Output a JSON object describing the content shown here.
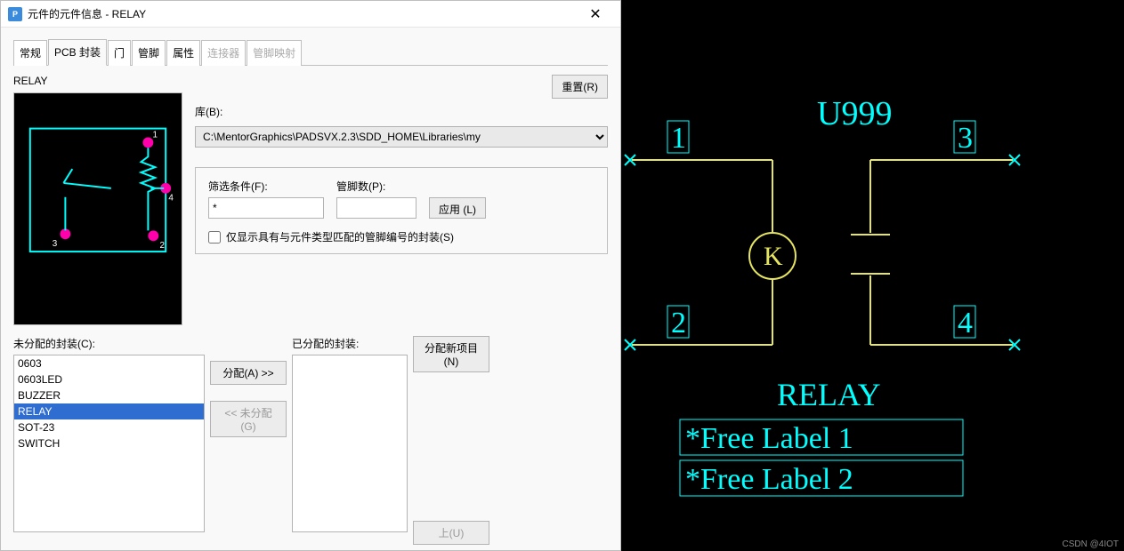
{
  "window": {
    "title": "元件的元件信息 - RELAY",
    "appicon_letter": "P"
  },
  "tabs": [
    {
      "label": "常规",
      "active": false,
      "disabled": false
    },
    {
      "label": "PCB 封装",
      "active": true,
      "disabled": false
    },
    {
      "label": "门",
      "active": false,
      "disabled": false
    },
    {
      "label": "管脚",
      "active": false,
      "disabled": false
    },
    {
      "label": "属性",
      "active": false,
      "disabled": false
    },
    {
      "label": "连接器",
      "active": false,
      "disabled": true
    },
    {
      "label": "管脚映射",
      "active": false,
      "disabled": true
    }
  ],
  "part_name": "RELAY",
  "reset_btn": "重置(R)",
  "library_label": "库(B):",
  "library_value": "C:\\MentorGraphics\\PADSVX.2.3\\SDD_HOME\\Libraries\\my",
  "filter": {
    "filter_label": "筛选条件(F):",
    "filter_value": "*",
    "pincount_label": "管脚数(P):",
    "pincount_value": "",
    "apply_btn": "应用 (L)",
    "only_match_chk": "仅显示具有与元件类型匹配的管脚编号的封装(S)",
    "only_match_checked": false
  },
  "unassigned_label": "未分配的封装(C):",
  "assigned_label": "已分配的封装:",
  "unassigned_items": [
    "0603",
    "0603LED",
    "BUZZER",
    "RELAY",
    "SOT-23",
    "SWITCH"
  ],
  "unassigned_selected": "RELAY",
  "assigned_items": [],
  "assign_btn": "分配(A) >>",
  "unassign_btn": "<< 未分配(G)",
  "assign_new_btn": "分配新项目(N)",
  "up_btn": "上(U)",
  "preview_pins": [
    "1",
    "2",
    "3",
    "4"
  ],
  "schematic": {
    "refdes": "U999",
    "pins": [
      "1",
      "2",
      "3",
      "4"
    ],
    "coil_letter": "K",
    "part_type": "RELAY",
    "free_labels": [
      "*Free Label 1",
      "*Free Label 2"
    ]
  },
  "watermark": "CSDN @4IOT"
}
